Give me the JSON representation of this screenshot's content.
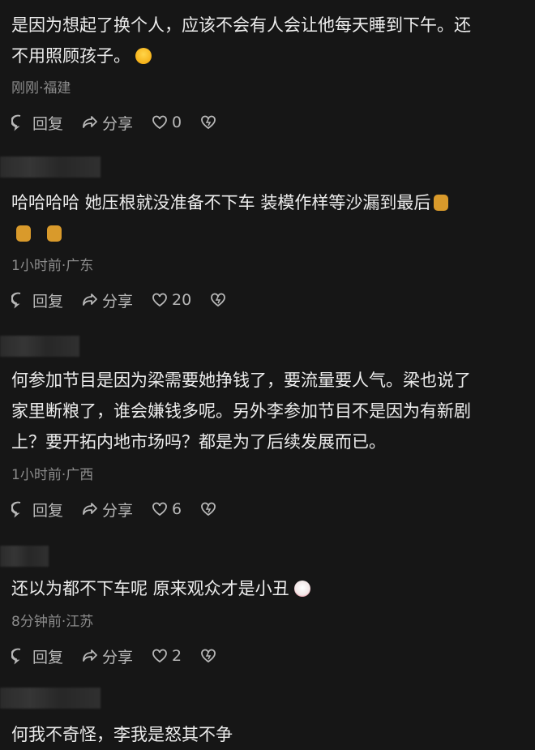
{
  "actions": {
    "reply": "回复",
    "share": "分享"
  },
  "comments": [
    {
      "lines": [
        "是因为想起了换个人，应该不会有人会让他每天睡到下午。还",
        "不用照顾孩子。"
      ],
      "meta": "刚刚·福建",
      "likes": "0"
    },
    {
      "lines": [
        "哈哈哈哈  她压根就没准备不下车  装模作样等沙漏到最后",
        ""
      ],
      "meta": "1小时前·广东",
      "likes": "20"
    },
    {
      "lines": [
        "何参加节目是因为梁需要她挣钱了，要流量要人气。梁也说了",
        "家里断粮了，谁会嫌钱多呢。另外李参加节目不是因为有新剧",
        "上？要开拓内地市场吗？都是为了后续发展而已。"
      ],
      "meta": "1小时前·广西",
      "likes": "6"
    },
    {
      "lines": [
        "还以为都不下车呢 原来观众才是小丑"
      ],
      "meta": "8分钟前·江苏",
      "likes": "2"
    },
    {
      "lines": [
        "何我不奇怪，李我是怒其不争"
      ]
    }
  ],
  "icons": [
    "reply-icon",
    "share-icon",
    "like-icon",
    "dislike-icon"
  ]
}
